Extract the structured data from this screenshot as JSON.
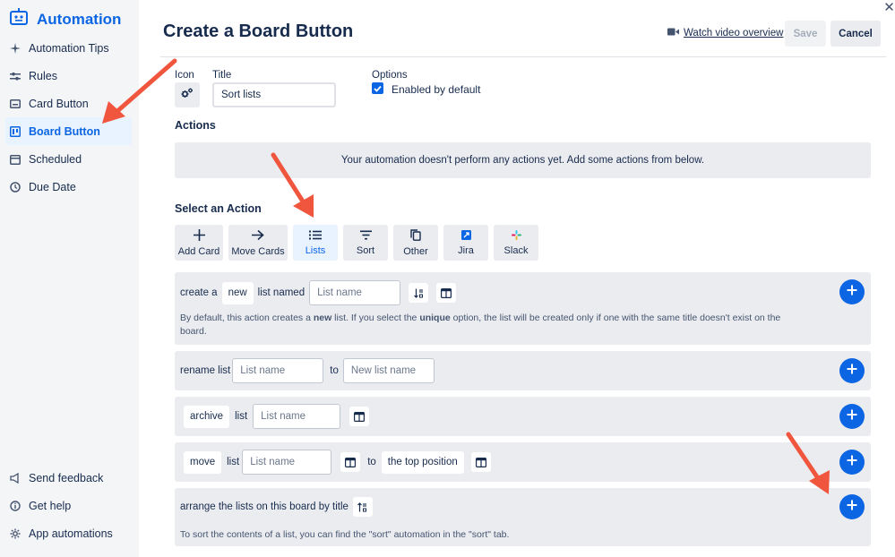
{
  "app": {
    "title": "Automation"
  },
  "sidebar": {
    "items": [
      {
        "label": "Automation Tips",
        "icon": "sparkle-icon"
      },
      {
        "label": "Rules",
        "icon": "sliders-icon"
      },
      {
        "label": "Card Button",
        "icon": "card-icon"
      },
      {
        "label": "Board Button",
        "icon": "board-icon",
        "active": true
      },
      {
        "label": "Scheduled",
        "icon": "calendar-icon"
      },
      {
        "label": "Due Date",
        "icon": "clock-icon"
      }
    ],
    "bottom": [
      {
        "label": "Send feedback",
        "icon": "megaphone-icon"
      },
      {
        "label": "Get help",
        "icon": "info-icon"
      },
      {
        "label": "App automations",
        "icon": "gear-icon"
      }
    ]
  },
  "header": {
    "title": "Create a Board Button",
    "watch_label": "Watch video overview",
    "save_label": "Save",
    "cancel_label": "Cancel"
  },
  "form": {
    "icon_label": "Icon",
    "title_label": "Title",
    "title_value": "Sort lists",
    "options_label": "Options",
    "enabled_label": "Enabled by default",
    "enabled_checked": true
  },
  "actions": {
    "heading": "Actions",
    "empty_message": "Your automation doesn't perform any actions yet. Add some actions from below."
  },
  "select_action": {
    "heading": "Select an Action",
    "tabs": [
      {
        "label": "Add Card",
        "icon": "plus-icon"
      },
      {
        "label": "Move Cards",
        "icon": "arrow-right-icon"
      },
      {
        "label": "Lists",
        "icon": "list-icon",
        "active": true
      },
      {
        "label": "Sort",
        "icon": "filter-icon"
      },
      {
        "label": "Other",
        "icon": "copy-icon"
      },
      {
        "label": "Jira",
        "icon": "jira-icon"
      },
      {
        "label": "Slack",
        "icon": "slack-icon"
      }
    ]
  },
  "cards": {
    "create": {
      "prefix": "create a",
      "chip": "new",
      "mid": "list named",
      "placeholder": "List name",
      "desc_1": "By default, this action creates a ",
      "desc_bold_1": "new",
      "desc_2": " list. If you select the ",
      "desc_bold_2": "unique",
      "desc_3": " option, the list will be created only if one with the same title doesn't exist on the",
      "desc_4": "board."
    },
    "rename": {
      "prefix": "rename list",
      "placeholder_1": "List name",
      "to": "to",
      "placeholder_2": "New list name"
    },
    "archive": {
      "chip": "archive",
      "mid": "list",
      "placeholder": "List name"
    },
    "move": {
      "chip": "move",
      "mid": "list",
      "placeholder": "List name",
      "to": "to",
      "position": "the top position"
    },
    "arrange": {
      "text": "arrange the lists on this board by title",
      "desc": "To sort the contents of a list, you can find the \"sort\" automation in the \"sort\" tab."
    }
  },
  "colors": {
    "accent": "#0c66e4",
    "annotation_arrow": "#f0553e",
    "sidebar_bg": "#f4f5f7",
    "card_bg": "#ebecf0"
  }
}
